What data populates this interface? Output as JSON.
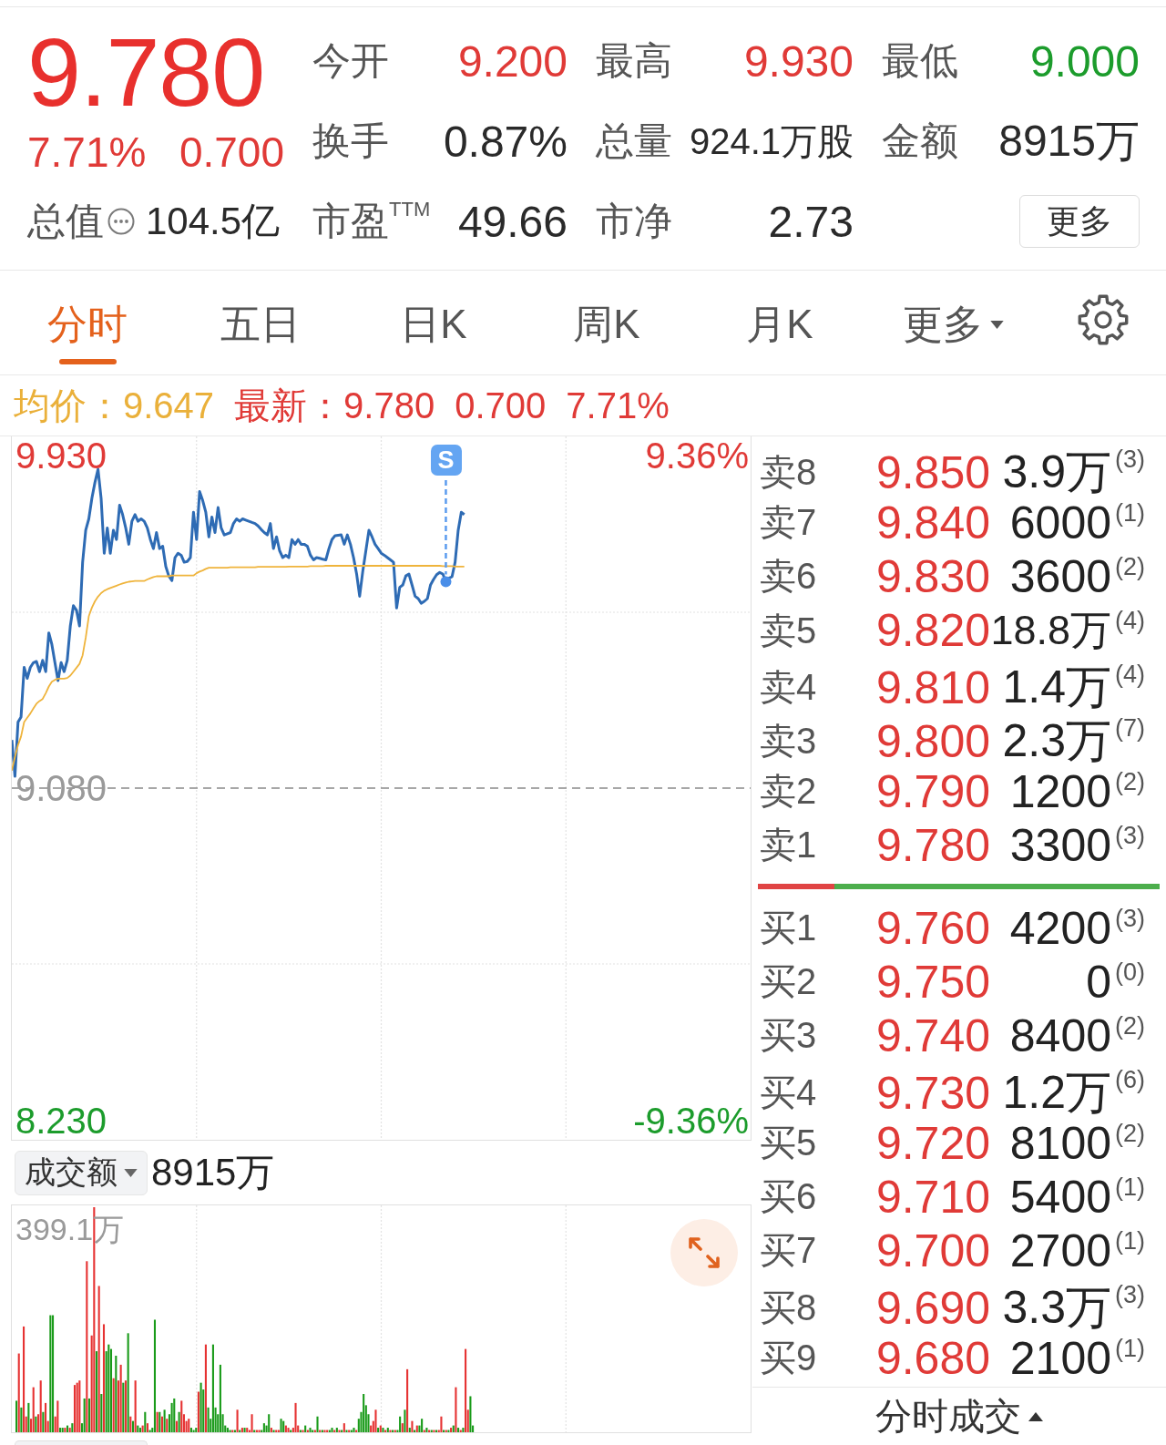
{
  "quote": {
    "price": "9.780",
    "change_percent": "7.71%",
    "change": "0.700",
    "stats": [
      {
        "label": "今开",
        "value": "9.200",
        "color": "#e03a37"
      },
      {
        "label": "最高",
        "value": "9.930",
        "color": "#e03a37"
      },
      {
        "label": "最低",
        "value": "9.000",
        "color": "#1c9c2c"
      },
      {
        "label": "换手",
        "value": "0.87%",
        "color": "#2a2a2a"
      },
      {
        "label": "总量",
        "value": "924.1万股",
        "color": "#2a2a2a"
      },
      {
        "label": "金额",
        "value": "8915万",
        "color": "#2a2a2a"
      },
      {
        "label": "市盈$^{TTM}$",
        "value": "49.66",
        "color": "#2a2a2a"
      },
      {
        "label": "市净",
        "value": "2.73",
        "color": "#2a2a2a"
      }
    ],
    "market_cap": {
      "label": "总值",
      "value": "104.5亿"
    },
    "more_button": "更多"
  },
  "tabs": [
    {
      "label": "分时",
      "kind": "tab",
      "selected": true
    },
    {
      "label": "五日",
      "kind": "tab",
      "selected": false
    },
    {
      "label": "日K",
      "kind": "tab",
      "selected": false
    },
    {
      "label": "周K",
      "kind": "tab",
      "selected": false
    },
    {
      "label": "月K",
      "kind": "tab",
      "selected": false
    },
    {
      "label": "更多",
      "kind": "dropdown",
      "selected": false
    }
  ],
  "quote_line": [
    {
      "text": "均价：9.647",
      "color": "#eab03a"
    },
    {
      "text": "最新：9.780",
      "color": "#e03a37"
    },
    {
      "text": "0.700",
      "color": "#e03a37"
    },
    {
      "text": "7.71%",
      "color": "#e03a37"
    }
  ],
  "price_chart": {
    "chart_data": {
      "type": "line",
      "categories": [
        null,
        null,
        null,
        null,
        null,
        null,
        null,
        null,
        null,
        null,
        null,
        null,
        null,
        null,
        null,
        null,
        null,
        null,
        null,
        null,
        null,
        null,
        null,
        null,
        null,
        null,
        null,
        null,
        null,
        null,
        null,
        null,
        null,
        null,
        null,
        null,
        null,
        null,
        null,
        null,
        null,
        null,
        null,
        null,
        null,
        null,
        null,
        null,
        null,
        null,
        null,
        null,
        null,
        null,
        null,
        null,
        null,
        null,
        null,
        null,
        null,
        null,
        null,
        null,
        null,
        null,
        null,
        null,
        null,
        null,
        null,
        null,
        null,
        null,
        null,
        null,
        null,
        null,
        null,
        null,
        null,
        null,
        null,
        null,
        null,
        null,
        null,
        null,
        null,
        null,
        null,
        null,
        null,
        null,
        null,
        null,
        null,
        null,
        null,
        null,
        null,
        null,
        null,
        null,
        null,
        null,
        null,
        null,
        null,
        null,
        null,
        null,
        null,
        null,
        null,
        null,
        null,
        null,
        null,
        null,
        null,
        null,
        null,
        null,
        null,
        null,
        null,
        null,
        null,
        null,
        null,
        null,
        null,
        null,
        null,
        null,
        null,
        null,
        null,
        null,
        null,
        null,
        null,
        null,
        null,
        null,
        null,
        null,
        null,
        null,
        null,
        null,
        null,
        null,
        null,
        null,
        null,
        null,
        null,
        null,
        null,
        null,
        null,
        null,
        null,
        null,
        null,
        null,
        null,
        null,
        null,
        null,
        null,
        null,
        null,
        null,
        null,
        null,
        null,
        null,
        null,
        null,
        null,
        null,
        null,
        null,
        null,
        null,
        null,
        null,
        null,
        null,
        null,
        null,
        null,
        null,
        null,
        null,
        null,
        null,
        null,
        null,
        null,
        null,
        null,
        null,
        null,
        null,
        null,
        null,
        null,
        null,
        null,
        null,
        null,
        null,
        null,
        null,
        null,
        null,
        null,
        null,
        null,
        null,
        null,
        null,
        null,
        null,
        null,
        null,
        null,
        null,
        null,
        null,
        null,
        null,
        null,
        null,
        null,
        null,
        null
      ],
      "series": [
        {
          "color": "#2e6bb4",
          "values": [
            9.203,
            9.11,
            9.249,
            9.262,
            9.389,
            9.361,
            9.389,
            9.401,
            9.404,
            9.378,
            9.407,
            9.378,
            9.477,
            9.448,
            9.401,
            9.355,
            9.401,
            9.378,
            9.407,
            9.495,
            9.547,
            9.535,
            9.495,
            9.658,
            9.74,
            9.769,
            9.822,
            9.862,
            9.896,
            9.822,
            9.681,
            9.746,
            9.681,
            9.74,
            9.716,
            9.804,
            9.78,
            9.746,
            9.704,
            9.763,
            9.78,
            9.763,
            9.769,
            9.763,
            9.746,
            9.716,
            9.693,
            9.734,
            9.693,
            9.699,
            9.647,
            9.623,
            9.611,
            9.67,
            9.681,
            9.676,
            9.658,
            9.66,
            9.67,
            9.786,
            9.716,
            9.839,
            9.816,
            9.786,
            9.723,
            9.774,
            9.734,
            9.798,
            9.746,
            9.728,
            9.731,
            9.734,
            9.757,
            9.769,
            9.763,
            9.769,
            9.766,
            9.763,
            9.76,
            9.757,
            9.751,
            9.742,
            9.734,
            9.728,
            9.757,
            9.693,
            9.723,
            9.687,
            9.67,
            9.676,
            9.67,
            9.716,
            9.704,
            9.716,
            9.704,
            9.704,
            9.699,
            9.676,
            9.664,
            9.67,
            9.668,
            9.666,
            9.664,
            9.693,
            9.716,
            9.726,
            9.727,
            9.728,
            9.704,
            9.728,
            9.704,
            9.67,
            9.628,
            9.571,
            9.634,
            9.687,
            9.74,
            9.723,
            9.704,
            9.693,
            9.681,
            9.676,
            9.67,
            9.664,
            9.658,
            9.541,
            9.594,
            9.6,
            9.623,
            9.628,
            9.6,
            9.571,
            9.565,
            9.553,
            9.558,
            9.565,
            9.6,
            9.614,
            9.626,
            9.632,
            9.628,
            9.608,
            9.617,
            9.621,
            9.658,
            9.74,
            9.786,
            9.78,
            null,
            null,
            null,
            null,
            null,
            null,
            null,
            null,
            null,
            null,
            null,
            null,
            null,
            null,
            null,
            null,
            null,
            null,
            null,
            null,
            null,
            null,
            null,
            null,
            null,
            null,
            null,
            null,
            null,
            null,
            null,
            null,
            null,
            null,
            null,
            null,
            null,
            null,
            null,
            null,
            null,
            null,
            null,
            null,
            null,
            null,
            null,
            null,
            null,
            null,
            null,
            null,
            null,
            null,
            null,
            null,
            null,
            null,
            null,
            null,
            null,
            null,
            null,
            null,
            null,
            null,
            null,
            null,
            null,
            null,
            null,
            null,
            null,
            null,
            null,
            null,
            null,
            null,
            null,
            null,
            null,
            null,
            null,
            null,
            null,
            null,
            null,
            null,
            null,
            null,
            null,
            null,
            null
          ]
        },
        {
          "color": "#efb43c",
          "values": [
            9.125,
            9.16,
            9.19,
            9.212,
            9.249,
            9.26,
            9.271,
            9.284,
            9.296,
            9.303,
            9.308,
            9.323,
            9.34,
            9.352,
            9.357,
            9.36,
            9.36,
            9.36,
            9.362,
            9.368,
            9.378,
            9.388,
            9.398,
            9.42,
            9.465,
            9.52,
            9.542,
            9.558,
            9.57,
            9.579,
            9.585,
            9.589,
            9.592,
            9.595,
            9.598,
            9.601,
            9.604,
            9.606,
            9.608,
            9.609,
            9.61,
            9.61,
            9.61,
            9.61,
            9.614,
            9.617,
            9.62,
            9.622,
            9.622,
            9.622,
            9.622,
            9.622,
            9.624,
            9.624,
            9.624,
            9.624,
            9.624,
            9.624,
            9.624,
            9.624,
            9.63,
            9.634,
            9.637,
            9.641,
            9.644,
            9.644,
            9.644,
            9.644,
            9.644,
            9.644,
            9.644,
            9.645,
            9.645,
            9.645,
            9.645,
            9.645,
            9.645,
            9.645,
            9.645,
            9.645,
            9.646,
            9.646,
            9.646,
            9.646,
            9.646,
            9.646,
            9.646,
            9.646,
            9.646,
            9.646,
            9.647,
            9.647,
            9.647,
            9.647,
            9.647,
            9.647,
            9.647,
            9.648,
            9.648,
            9.648,
            9.648,
            9.648,
            9.649,
            9.649,
            9.649,
            9.649,
            9.649,
            9.649,
            9.649,
            9.649,
            9.649,
            9.649,
            9.649,
            9.649,
            9.649,
            9.649,
            9.649,
            9.649,
            9.649,
            9.649,
            9.649,
            9.649,
            9.649,
            9.649,
            9.649,
            9.649,
            9.649,
            9.649,
            9.649,
            9.649,
            9.649,
            9.649,
            9.649,
            9.649,
            9.649,
            9.649,
            9.649,
            9.649,
            9.649,
            9.649,
            9.648,
            9.648,
            9.648,
            9.648,
            9.647,
            9.647,
            9.647,
            9.647,
            null,
            null,
            null,
            null,
            null,
            null,
            null,
            null,
            null,
            null,
            null,
            null,
            null,
            null,
            null,
            null,
            null,
            null,
            null,
            null,
            null,
            null,
            null,
            null,
            null,
            null,
            null,
            null,
            null,
            null,
            null,
            null,
            null,
            null,
            null,
            null,
            null,
            null,
            null,
            null,
            null,
            null,
            null,
            null,
            null,
            null,
            null,
            null,
            null,
            null,
            null,
            null,
            null,
            null,
            null,
            null,
            null,
            null,
            null,
            null,
            null,
            null,
            null,
            null,
            null,
            null,
            null,
            null,
            null,
            null,
            null,
            null,
            null,
            null,
            null,
            null,
            null,
            null,
            null,
            null,
            null,
            null,
            null,
            null,
            null,
            null,
            null,
            null,
            null,
            null,
            null,
            null,
            null
          ]
        },
        {
          "name": "S",
          "color": "#4a8ee8",
          "marker": "o",
          "values": [
            null,
            null,
            null,
            null,
            null,
            null,
            null,
            null,
            null,
            null,
            null,
            null,
            null,
            null,
            null,
            null,
            null,
            null,
            null,
            null,
            null,
            null,
            null,
            null,
            null,
            null,
            null,
            null,
            null,
            null,
            null,
            null,
            null,
            null,
            null,
            null,
            null,
            null,
            null,
            null,
            null,
            null,
            null,
            null,
            null,
            null,
            null,
            null,
            null,
            null,
            null,
            null,
            null,
            null,
            null,
            null,
            null,
            null,
            null,
            null,
            null,
            null,
            null,
            null,
            null,
            null,
            null,
            null,
            null,
            null,
            null,
            null,
            null,
            null,
            null,
            null,
            null,
            null,
            null,
            null,
            null,
            null,
            null,
            null,
            null,
            null,
            null,
            null,
            null,
            null,
            null,
            null,
            null,
            null,
            null,
            null,
            null,
            null,
            null,
            null,
            null,
            null,
            null,
            null,
            null,
            null,
            null,
            null,
            null,
            null,
            null,
            null,
            null,
            null,
            null,
            null,
            null,
            null,
            null,
            null,
            null,
            null,
            null,
            null,
            null,
            null,
            null,
            null,
            null,
            null,
            null,
            null,
            null,
            null,
            null,
            null,
            null,
            null,
            null,
            null,
            null,
            9.608,
            null,
            null,
            null,
            null,
            null,
            null,
            null,
            null,
            null,
            null,
            null,
            null,
            null,
            null,
            null,
            null,
            null,
            null,
            null,
            null,
            null,
            null,
            null,
            null,
            null,
            null,
            null,
            null,
            null,
            null,
            null,
            null,
            null,
            null,
            null,
            null,
            null,
            null,
            null,
            null,
            null,
            null,
            null,
            null,
            null,
            null,
            null,
            null,
            null,
            null,
            null,
            null,
            null,
            null,
            null,
            null,
            null,
            null,
            null,
            null,
            null,
            null,
            null,
            null,
            null,
            null,
            null,
            null,
            null,
            null,
            null,
            null,
            null,
            null,
            null,
            null,
            null,
            null,
            null,
            null,
            null,
            null,
            null,
            null,
            null,
            null,
            null,
            null,
            null,
            null,
            null,
            null,
            null,
            null,
            null,
            null,
            null,
            null,
            null
          ]
        }
      ],
      "ylim": [
        8.18,
        9.98
      ],
      "yticks": [
        {
          "value": 9.93,
          "label": "9.930"
        },
        {
          "value": 9.08,
          "label": "9.080"
        },
        {
          "value": 8.23,
          "label": "8.230"
        }
      ],
      "ref_lines": [
        {
          "axis": "y",
          "value": 9.08
        }
      ]
    },
    "change_ticks": [
      {
        "text": "9.36%",
        "color": "#e03a37"
      },
      {
        "text": "-9.36%",
        "color": "#1c9c2c"
      }
    ]
  },
  "volume": {
    "metric": "成交额",
    "value": "8915万",
    "max_label": "399.1万"
  },
  "order_book": {
    "asks": [
      {
        "label": "卖8",
        "price": "9.850",
        "volume": "3.9万",
        "count": "(3)"
      },
      {
        "label": "卖7",
        "price": "9.840",
        "volume": "6000",
        "count": "(1)"
      },
      {
        "label": "卖6",
        "price": "9.830",
        "volume": "3600",
        "count": "(2)"
      },
      {
        "label": "卖5",
        "price": "9.820",
        "volume": "18.8万",
        "count": "(4)"
      },
      {
        "label": "卖4",
        "price": "9.810",
        "volume": "1.4万",
        "count": "(4)"
      },
      {
        "label": "卖3",
        "price": "9.800",
        "volume": "2.3万",
        "count": "(7)"
      },
      {
        "label": "卖2",
        "price": "9.790",
        "volume": "1200",
        "count": "(2)"
      },
      {
        "label": "卖1",
        "price": "9.780",
        "volume": "3300",
        "count": "(3)"
      }
    ],
    "ratio": {
      "level": 0.19
    },
    "bids": [
      {
        "label": "买1",
        "price": "9.760",
        "volume": "4200",
        "count": "(3)"
      },
      {
        "label": "买2",
        "price": "9.750",
        "volume": "0",
        "count": "(0)"
      },
      {
        "label": "买3",
        "price": "9.740",
        "volume": "8400",
        "count": "(2)"
      },
      {
        "label": "买4",
        "price": "9.730",
        "volume": "1.2万",
        "count": "(6)"
      },
      {
        "label": "买5",
        "price": "9.720",
        "volume": "8100",
        "count": "(2)"
      },
      {
        "label": "买6",
        "price": "9.710",
        "volume": "5400",
        "count": "(1)"
      },
      {
        "label": "买7",
        "price": "9.700",
        "volume": "2700",
        "count": "(1)"
      },
      {
        "label": "买8",
        "price": "9.690",
        "volume": "3.3万",
        "count": "(3)"
      },
      {
        "label": "买9",
        "price": "9.680",
        "volume": "2100",
        "count": "(1)"
      }
    ],
    "trades_tab": "分时成交"
  }
}
